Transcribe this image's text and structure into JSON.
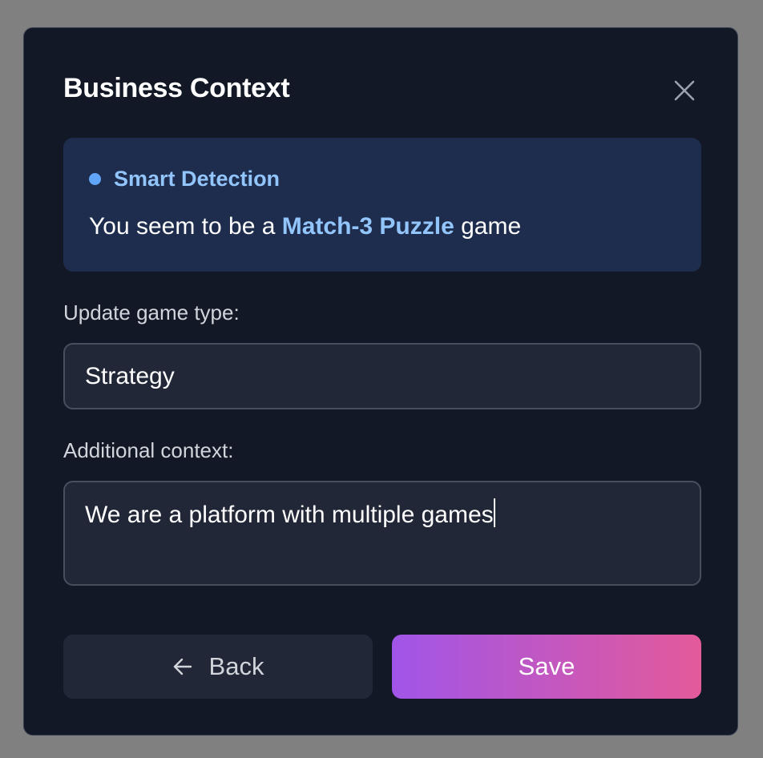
{
  "dialog": {
    "title": "Business Context",
    "close_icon": "close-icon"
  },
  "smart_detection": {
    "label": "Smart Detection",
    "text_before": "You seem to be a ",
    "highlight": "Match-3 Puzzle",
    "text_after": " game",
    "accent_color": "#93c5fd"
  },
  "game_type": {
    "label": "Update game type:",
    "value": "Strategy"
  },
  "additional_context": {
    "label": "Additional context:",
    "value": "We are a platform with multiple games"
  },
  "actions": {
    "back_label": "Back",
    "back_icon": "arrow-left-icon",
    "save_label": "Save",
    "save_gradient": [
      "#a155e8",
      "#e35a9a"
    ]
  },
  "colors": {
    "overlay": "#808080",
    "modal_bg": "#131826",
    "detection_bg": "#1e2d4d",
    "field_bg": "#212736"
  }
}
